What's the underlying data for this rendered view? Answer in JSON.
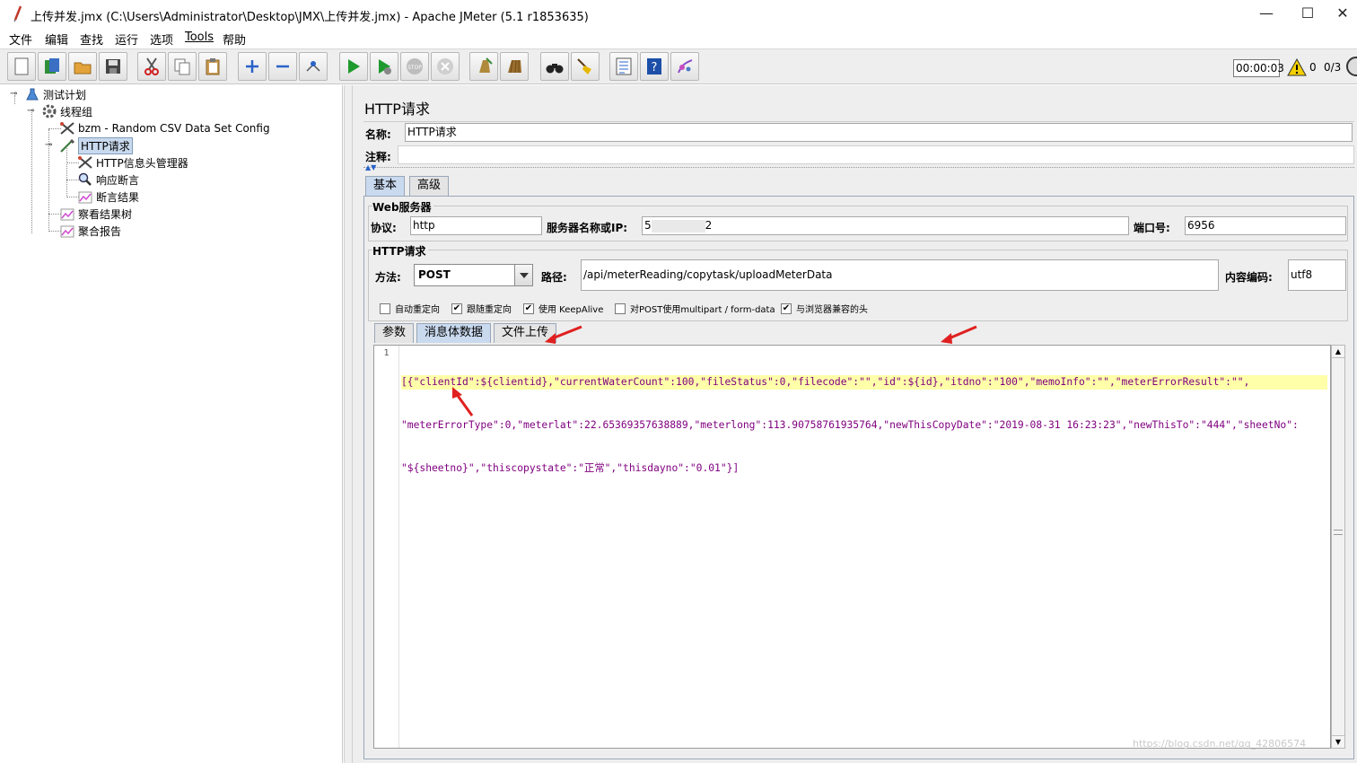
{
  "window": {
    "title": "上传并发.jmx (C:\\Users\\Administrator\\Desktop\\JMX\\上传并发.jmx) - Apache JMeter (5.1 r1853635)",
    "minimize": "—",
    "maximize": "☐",
    "close": "✕"
  },
  "menu": [
    "文件",
    "编辑",
    "查找",
    "运行",
    "选项",
    "Tools",
    "帮助"
  ],
  "toolbar": {
    "timer": "00:00:03",
    "error_count": "0",
    "threads": "0/3",
    "icons": [
      "new-icon",
      "templates-icon",
      "open-icon",
      "save-icon",
      "cut-icon",
      "copy-icon",
      "paste-icon",
      "expand-icon",
      "collapse-icon",
      "toggle-icon",
      "start-icon",
      "start-no-pause-icon",
      "stop-icon",
      "shutdown-icon",
      "clear-icon",
      "clear-all-icon",
      "search-icon",
      "reset-search-icon",
      "function-helper-icon",
      "help-icon",
      "remote-icon"
    ]
  },
  "tree": {
    "items": [
      {
        "label": "测试计划",
        "icon": "test-plan-icon"
      },
      {
        "label": "线程组",
        "icon": "gear-icon"
      },
      {
        "label": "bzm - Random CSV Data Set Config",
        "icon": "wrench-icon"
      },
      {
        "label": "HTTP请求",
        "icon": "pipette-icon"
      },
      {
        "label": "HTTP信息头管理器",
        "icon": "wrench-icon"
      },
      {
        "label": "响应断言",
        "icon": "magnifier-icon"
      },
      {
        "label": "断言结果",
        "icon": "chart-icon"
      },
      {
        "label": "察看结果树",
        "icon": "chart-icon"
      },
      {
        "label": "聚合报告",
        "icon": "chart-icon"
      }
    ]
  },
  "sampler": {
    "title": "HTTP请求",
    "name_label": "名称:",
    "name_value": "HTTP请求",
    "comment_label": "注释:",
    "comment_value": "",
    "tabs": [
      "基本",
      "高级"
    ],
    "web_server_group": "Web服务器",
    "protocol_label": "协议:",
    "protocol_value": "http",
    "server_label": "服务器名称或IP:",
    "server_prefix": "5",
    "server_suffix": "2",
    "port_label": "端口号:",
    "port_value": "6956",
    "http_group": "HTTP请求",
    "method_label": "方法:",
    "method_value": "POST",
    "path_label": "路径:",
    "path_value": "/api/meterReading/copytask/uploadMeterData",
    "encoding_label": "内容编码:",
    "encoding_value": "utf8",
    "checkboxes": [
      {
        "label": "自动重定向",
        "checked": false
      },
      {
        "label": "跟随重定向",
        "checked": true
      },
      {
        "label": "使用 KeepAlive",
        "checked": true
      },
      {
        "label": "对POST使用multipart / form-data",
        "checked": false
      },
      {
        "label": "与浏览器兼容的头",
        "checked": true
      }
    ],
    "body_tabs": [
      "参数",
      "消息体数据",
      "文件上传"
    ],
    "body_line_number": "1",
    "body_line1": "[{\"clientId\":${clientid},\"currentWaterCount\":100,\"fileStatus\":0,\"filecode\":\"\",\"id\":${id},\"itdno\":\"100\",\"memoInfo\":\"\",\"meterErrorResult\":\"\",",
    "body_line2": "\"meterErrorType\":0,\"meterlat\":22.65369357638889,\"meterlong\":113.90758761935764,\"newThisCopyDate\":\"2019-08-31 16:23:23\",\"newThisTo\":\"444\",\"sheetNo\":",
    "body_line3": "\"${sheetno}\",\"thiscopystate\":\"正常\",\"thisdayno\":\"0.01\"}]"
  },
  "watermark": "https://blog.csdn.net/qq_42806574"
}
